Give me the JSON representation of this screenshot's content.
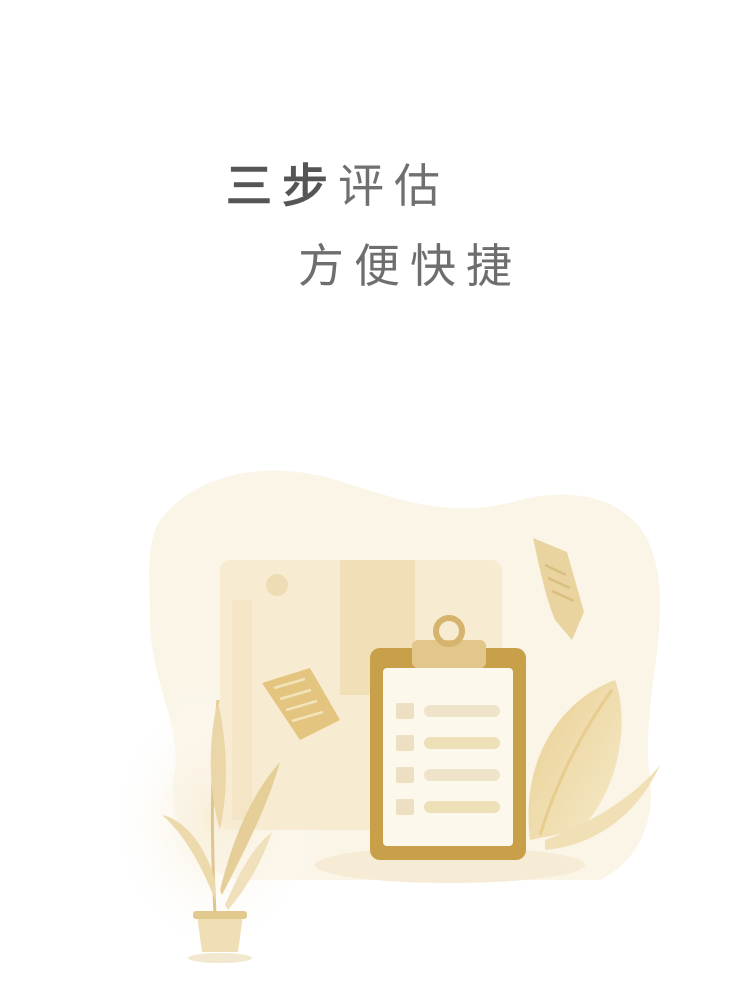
{
  "headline": {
    "line1_bold": "三步",
    "line1_light": "评估",
    "line2": "方便快捷"
  },
  "colors": {
    "accent_gold": "#C9A04A",
    "blob_cream": "#FBF5E8",
    "paper_cream": "#FDF8EC",
    "clipboard_bar": "#E6D3A4"
  },
  "illustration": {
    "icon_names": [
      "clipboard-icon",
      "document-icon",
      "plant-pot-icon",
      "leaf-icon",
      "box-icon"
    ],
    "checklist_items": 4
  }
}
